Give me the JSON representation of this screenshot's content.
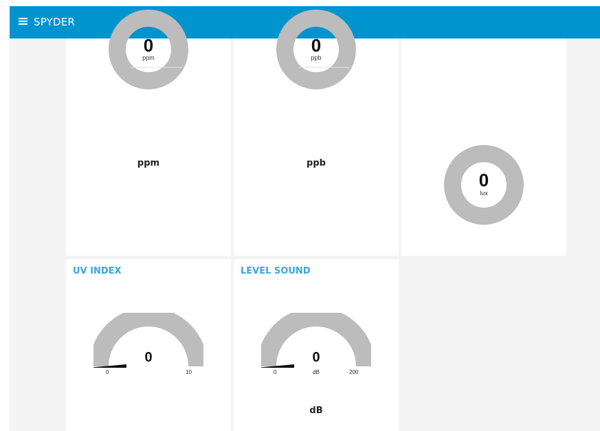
{
  "header": {
    "title": "SPYDER",
    "background_color": "#0094ce",
    "menu_icon": "hamburger-menu-icon"
  },
  "accent_color": "#35a9dd",
  "donuts": [
    {
      "value": "0",
      "unit": "ppm",
      "label": "ppm",
      "fill_fraction": 0
    },
    {
      "value": "0",
      "unit": "ppb",
      "label": "ppb",
      "fill_fraction": 0
    },
    {
      "value": "0",
      "unit": "lux",
      "fill_fraction": 0
    }
  ],
  "gauges": [
    {
      "title": "UV INDEX",
      "value": "0",
      "min": "0",
      "max": "10",
      "fill_fraction": 0
    },
    {
      "title": "LEVEL SOUND",
      "value": "0",
      "unit": "dB",
      "min": "0",
      "max": "200",
      "label": "dB",
      "fill_fraction": 0
    }
  ]
}
